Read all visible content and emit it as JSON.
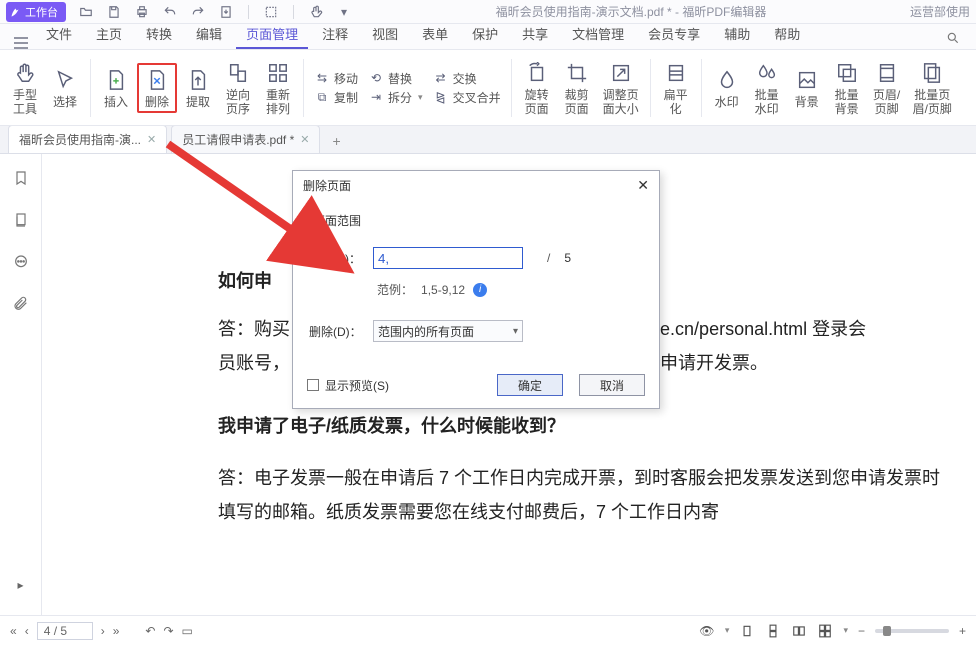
{
  "titlebar": {
    "workbench": "工作台",
    "doc_title": "福昕会员使用指南-演示文档.pdf * - 福昕PDF编辑器",
    "right": "运营部使用"
  },
  "menu": {
    "file": "文件",
    "items": [
      "主页",
      "转换",
      "编辑",
      "页面管理",
      "注释",
      "视图",
      "表单",
      "保护",
      "共享",
      "文档管理",
      "会员专享",
      "辅助",
      "帮助"
    ],
    "active_index": 3
  },
  "ribbon": {
    "hand": "手型\n工具",
    "select": "选择",
    "insert": "插入",
    "delete": "删除",
    "extract": "提取",
    "reverse": "逆向\n页序",
    "rearrange": "重新\n排列",
    "move": "移动",
    "copy": "复制",
    "replace": "替换",
    "split": "拆分",
    "swap": "交换",
    "swap_merge": "交叉合并",
    "rotate": "旋转\n页面",
    "crop": "裁剪\n页面",
    "resize": "调整页\n面大小",
    "flatten": "扁平\n化",
    "watermark": "水印",
    "batch_wm": "批量\n水印",
    "background": "背景",
    "batch_bg": "批量\n背景",
    "headerfooter": "页眉/\n页脚",
    "batch_hf": "批量页\n眉/页脚"
  },
  "tabs": {
    "t1": "福昕会员使用指南-演...",
    "t2": "员工请假申请表.pdf *"
  },
  "document": {
    "h1": "如何申",
    "p1a": "答：购买",
    "p1b": "e.cn/personal.html 登录会",
    "p1c": "员账号，",
    "p1d": "申请开发票。",
    "h2": "我申请了电子/纸质发票，什么时候能收到？",
    "p2": "答：电子发票一般在申请后 7 个工作日内完成开票，到时客服会把发票发送到您申请发票时填写的邮箱。纸质发票需要您在线支付邮费后，7 个工作日内寄"
  },
  "dialog": {
    "title": "删除页面",
    "section": "页面范围",
    "page_label": "页面(P)：",
    "page_value": "4,",
    "total": "5",
    "example_label": "范例：",
    "example_value": "1,5-9,12",
    "delete_label": "删除(D)：",
    "delete_value": "范围内的所有页面",
    "show_preview": "显示预览(S)",
    "ok": "确定",
    "cancel": "取消"
  },
  "status": {
    "page": "4 / 5"
  }
}
